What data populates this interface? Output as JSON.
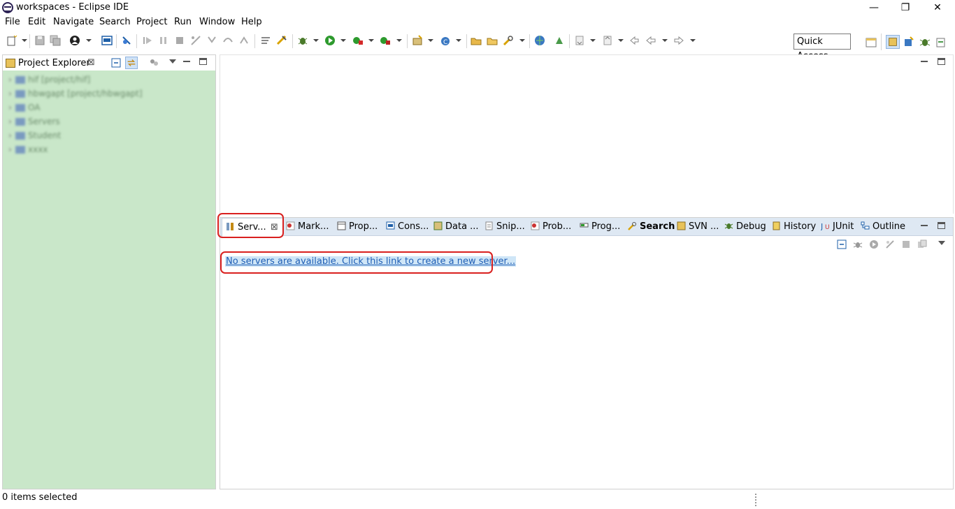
{
  "window": {
    "title": "workspaces - Eclipse IDE",
    "controls": {
      "minimize": "—",
      "restore": "❐",
      "close": "✕"
    }
  },
  "menu": [
    "File",
    "Edit",
    "Navigate",
    "Search",
    "Project",
    "Run",
    "Window",
    "Help"
  ],
  "toolbar": {
    "quick_access": "Quick Access"
  },
  "project_explorer": {
    "tab_label": "Project Explorer",
    "close_glyph": "⊠",
    "items": [
      {
        "name": "hif",
        "suffix": "[project/hif]"
      },
      {
        "name": "hbwgapt",
        "suffix": "[project/hbwgapt]"
      },
      {
        "name": "OA",
        "suffix": ""
      },
      {
        "name": "Servers",
        "suffix": ""
      },
      {
        "name": "Student",
        "suffix": ""
      },
      {
        "name": "xxxx",
        "suffix": ""
      }
    ]
  },
  "bottom_panel": {
    "tabs": [
      {
        "label": "Serv...",
        "active": true,
        "close": "⊠"
      },
      {
        "label": "Mark...",
        "active": false
      },
      {
        "label": "Prop...",
        "active": false
      },
      {
        "label": "Cons...",
        "active": false
      },
      {
        "label": "Data ...",
        "active": false
      },
      {
        "label": "Snip...",
        "active": false
      },
      {
        "label": "Prob...",
        "active": false
      },
      {
        "label": "Prog...",
        "active": false
      },
      {
        "label": "Search",
        "active": false
      },
      {
        "label": "SVN ...",
        "active": false
      },
      {
        "label": "Debug",
        "active": false
      },
      {
        "label": "History",
        "active": false
      },
      {
        "label": "JUnit",
        "active": false
      },
      {
        "label": "Outline",
        "active": false
      }
    ],
    "server_link": "No servers are available. Click this link to create a new server..."
  },
  "status": {
    "text": "0 items selected"
  },
  "colors": {
    "tree_bg": "#c9e7c9",
    "tabbar_bg": "#dee8f3",
    "highlight_outline": "#d9201f",
    "link": "#1f5eb5"
  }
}
